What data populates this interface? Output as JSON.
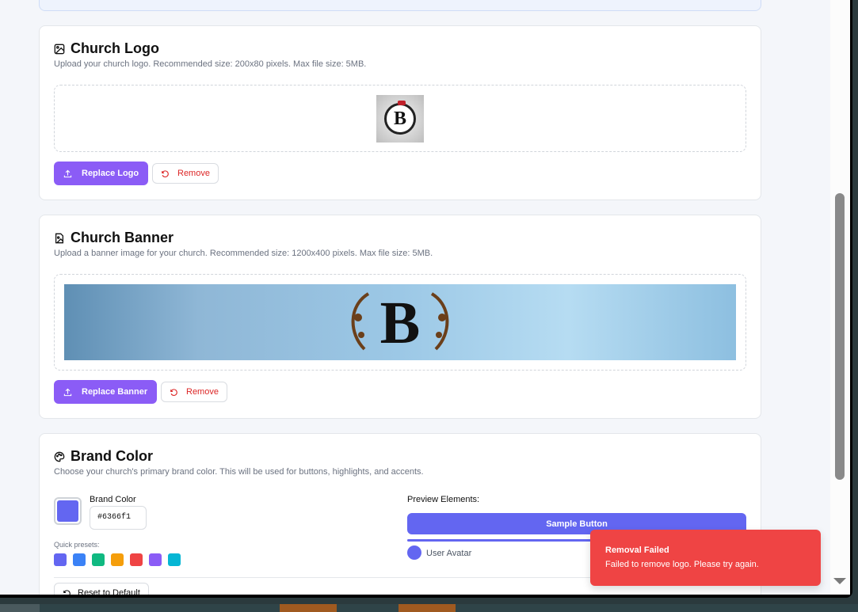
{
  "logo_section": {
    "title": "Church Logo",
    "description": "Upload your church logo. Recommended size: 200x80 pixels. Max file size: 5MB.",
    "logo_letter": "B",
    "replace_label": "Replace Logo",
    "remove_label": "Remove"
  },
  "banner_section": {
    "title": "Church Banner",
    "description": "Upload a banner image for your church. Recommended size: 1200x400 pixels. Max file size: 5MB.",
    "replace_label": "Replace Banner",
    "remove_label": "Remove"
  },
  "brand_section": {
    "title": "Brand Color",
    "description": "Choose your church's primary brand color. This will be used for buttons, highlights, and accents.",
    "color_label": "Brand Color",
    "hex_value": "#6366f1",
    "presets_label": "Quick presets:",
    "presets": [
      "#6366f1",
      "#3b82f6",
      "#10b981",
      "#f59e0b",
      "#ef4444",
      "#8b5cf6",
      "#06b6d4"
    ],
    "preview_label": "Preview Elements:",
    "sample_button_label": "Sample Button",
    "avatar_label": "User Avatar",
    "reset_label": "Reset to Default"
  },
  "toast": {
    "title": "Removal Failed",
    "message": "Failed to remove logo. Please try again."
  },
  "colors": {
    "accent": "#8b5cf6",
    "brand": "#6366f1",
    "danger": "#ef4444"
  }
}
